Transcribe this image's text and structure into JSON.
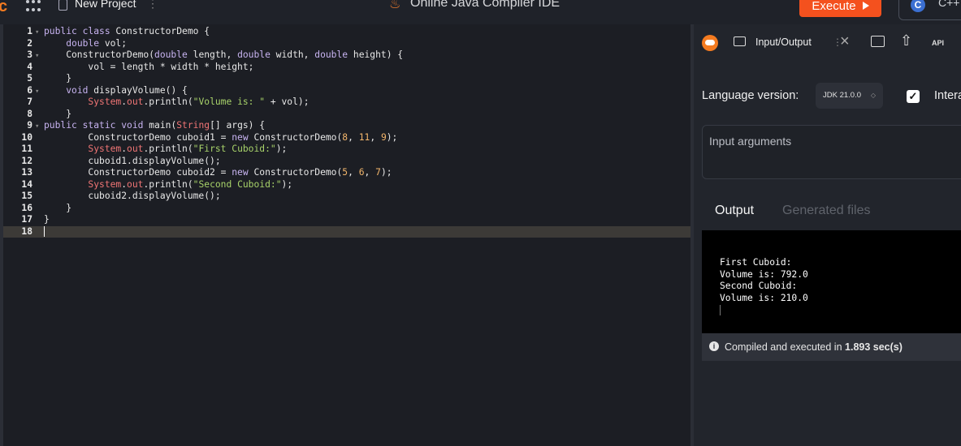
{
  "header": {
    "brand": "c",
    "project_name": "New Project",
    "project_menu": "⋮",
    "title": "Online Java Compiler IDE",
    "execute_label": "Execute",
    "language_logo": "C",
    "language_label": "C++"
  },
  "editor": {
    "lines": [
      {
        "n": "1",
        "fold": true,
        "code": [
          [
            "k",
            "public class "
          ],
          [
            "p",
            "ConstructorDemo {"
          ]
        ]
      },
      {
        "n": "2",
        "fold": false,
        "code": [
          [
            "p",
            "    "
          ],
          [
            "k",
            "double "
          ],
          [
            "p",
            "vol;"
          ]
        ]
      },
      {
        "n": "3",
        "fold": true,
        "code": [
          [
            "p",
            "    ConstructorDemo("
          ],
          [
            "k",
            "double "
          ],
          [
            "p",
            "length, "
          ],
          [
            "k",
            "double "
          ],
          [
            "p",
            "width, "
          ],
          [
            "k",
            "double "
          ],
          [
            "p",
            "height) {"
          ]
        ]
      },
      {
        "n": "4",
        "fold": false,
        "code": [
          [
            "p",
            "        vol = length * width * height;"
          ]
        ]
      },
      {
        "n": "5",
        "fold": false,
        "code": [
          [
            "p",
            "    }"
          ]
        ]
      },
      {
        "n": "6",
        "fold": true,
        "code": [
          [
            "p",
            "    "
          ],
          [
            "k",
            "void "
          ],
          [
            "p",
            "displayVolume() {"
          ]
        ]
      },
      {
        "n": "7",
        "fold": false,
        "code": [
          [
            "p",
            "        "
          ],
          [
            "r",
            "System"
          ],
          [
            "p",
            "."
          ],
          [
            "r",
            "out"
          ],
          [
            "p",
            ".println("
          ],
          [
            "s",
            "\"Volume is: \""
          ],
          [
            "p",
            " + vol);"
          ]
        ]
      },
      {
        "n": "8",
        "fold": false,
        "code": [
          [
            "p",
            "    }"
          ]
        ]
      },
      {
        "n": "9",
        "fold": true,
        "code": [
          [
            "k",
            "public static void "
          ],
          [
            "p",
            "main("
          ],
          [
            "r",
            "String"
          ],
          [
            "p",
            "[] args) {"
          ]
        ]
      },
      {
        "n": "10",
        "fold": false,
        "code": [
          [
            "p",
            "        ConstructorDemo cuboid1 = "
          ],
          [
            "k",
            "new "
          ],
          [
            "p",
            "ConstructorDemo("
          ],
          [
            "n",
            "8"
          ],
          [
            "p",
            ", "
          ],
          [
            "n",
            "11"
          ],
          [
            "p",
            ", "
          ],
          [
            "n",
            "9"
          ],
          [
            "p",
            ");"
          ]
        ]
      },
      {
        "n": "11",
        "fold": false,
        "code": [
          [
            "p",
            "        "
          ],
          [
            "r",
            "System"
          ],
          [
            "p",
            "."
          ],
          [
            "r",
            "out"
          ],
          [
            "p",
            ".println("
          ],
          [
            "s",
            "\"First Cuboid:\""
          ],
          [
            "p",
            ");"
          ]
        ]
      },
      {
        "n": "12",
        "fold": false,
        "code": [
          [
            "p",
            "        cuboid1.displayVolume();"
          ]
        ]
      },
      {
        "n": "13",
        "fold": false,
        "code": [
          [
            "p",
            "        ConstructorDemo cuboid2 = "
          ],
          [
            "k",
            "new "
          ],
          [
            "p",
            "ConstructorDemo("
          ],
          [
            "n",
            "5"
          ],
          [
            "p",
            ", "
          ],
          [
            "n",
            "6"
          ],
          [
            "p",
            ", "
          ],
          [
            "n",
            "7"
          ],
          [
            "p",
            ");"
          ]
        ]
      },
      {
        "n": "14",
        "fold": false,
        "code": [
          [
            "p",
            "        "
          ],
          [
            "r",
            "System"
          ],
          [
            "p",
            "."
          ],
          [
            "r",
            "out"
          ],
          [
            "p",
            ".println("
          ],
          [
            "s",
            "\"Second Cuboid:\""
          ],
          [
            "p",
            ");"
          ]
        ]
      },
      {
        "n": "15",
        "fold": false,
        "code": [
          [
            "p",
            "        cuboid2.displayVolume();"
          ]
        ]
      },
      {
        "n": "16",
        "fold": false,
        "code": [
          [
            "p",
            "    }"
          ]
        ]
      },
      {
        "n": "17",
        "fold": false,
        "code": [
          [
            "p",
            "}"
          ]
        ]
      },
      {
        "n": "18",
        "fold": false,
        "code": [],
        "active": true
      }
    ]
  },
  "panel": {
    "tab_label": "Input/Output",
    "tab_menu": "⋮",
    "api_label": "API",
    "language_version_label": "Language version:",
    "jdk_value": "JDK 21.0.0",
    "interactive_label": "Interactive",
    "input_placeholder": "Input arguments",
    "output_tab": "Output",
    "generated_tab": "Generated files",
    "console_lines": [
      "First Cuboid:",
      "Volume is: 792.0",
      "Second Cuboid:",
      "Volume is: 210.0"
    ],
    "status_prefix": "Compiled and executed in ",
    "status_time": "1.893 sec(s)"
  },
  "colors": {
    "execute": "#f4511e",
    "brand": "#f47b20",
    "keyword": "#c7b3f0",
    "string": "#a8d36a",
    "number": "#f2b56b",
    "class_ref": "#f07575"
  },
  "icons": [
    "apps-grid-icon",
    "document-icon",
    "java-icon",
    "play-icon",
    "bot-icon",
    "terminal-icon",
    "close-icon",
    "folder-icon",
    "upload-icon",
    "chevron-updown-icon",
    "checkbox-icon",
    "info-icon"
  ]
}
